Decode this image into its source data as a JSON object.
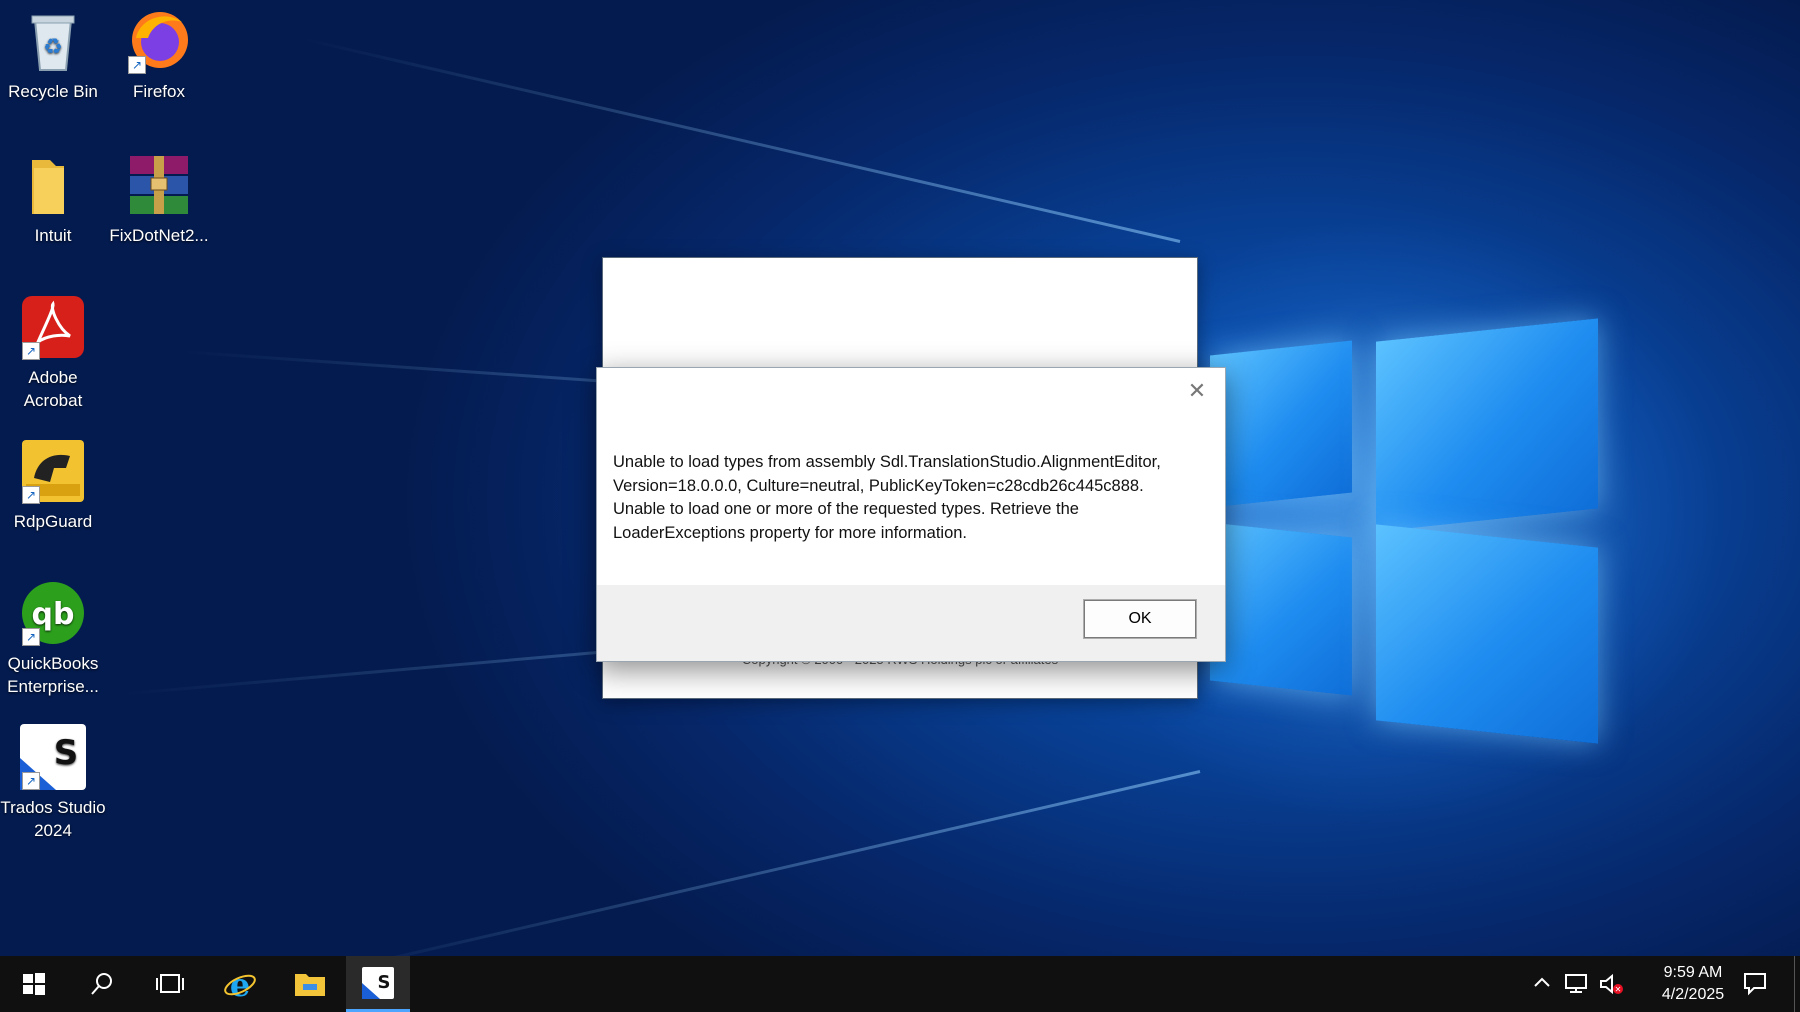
{
  "desktop": {
    "icons": [
      {
        "label": "Recycle Bin",
        "icon": "recycle-bin-icon"
      },
      {
        "label": "Firefox",
        "icon": "firefox-icon"
      },
      {
        "label": "Intuit",
        "icon": "folder-icon"
      },
      {
        "label": "FixDotNet2...",
        "icon": "winrar-icon"
      },
      {
        "label": "Adobe Acrobat",
        "icon": "adobe-acrobat-icon"
      },
      {
        "label": "RdpGuard",
        "icon": "rdpguard-icon"
      },
      {
        "label": "QuickBooks Enterprise...",
        "icon": "quickbooks-icon"
      },
      {
        "label": "Trados Studio 2024",
        "icon": "trados-studio-icon"
      }
    ]
  },
  "splash": {
    "copyright": "Copyright © 2000 - 2025 RWS Holdings plc or affiliates"
  },
  "dialog": {
    "close_glyph": "✕",
    "message_lines": [
      "Unable to load types from assembly Sdl.TranslationStudio.AlignmentEditor,",
      "Version=18.0.0.0, Culture=neutral, PublicKeyToken=c28cdb26c445c888.",
      "Unable to load one or more of the requested types. Retrieve the",
      "LoaderExceptions property for more information."
    ],
    "ok_label": "OK"
  },
  "taskbar": {
    "items": [
      "start-icon",
      "search-icon",
      "task-view-icon",
      "internet-explorer-icon",
      "file-explorer-icon",
      "trados-studio-icon"
    ],
    "tray": {
      "time": "9:59 AM",
      "date": "4/2/2025"
    }
  },
  "colors": {
    "desktop_blue": "#0b4fae",
    "logo_blue": "#2a95f2",
    "taskbar": "#101010",
    "active_indicator": "#4ca6ff"
  }
}
